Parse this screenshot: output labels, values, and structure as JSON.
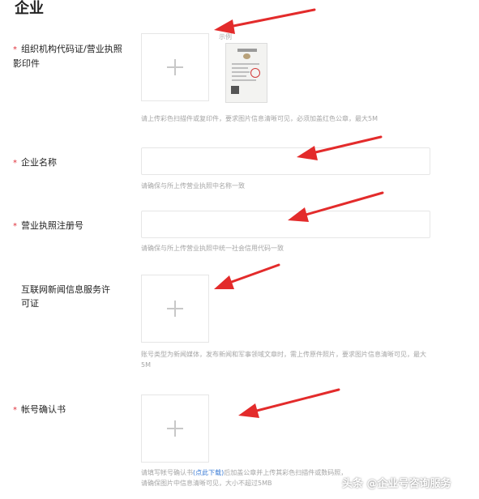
{
  "page": {
    "title": "企业"
  },
  "example_label": "示例",
  "fields": {
    "org_code": {
      "required": true,
      "label": "组织机构代码证/营业执照影印件",
      "hint": "请上传彩色扫描件或复印件，要求图片信息清晰可见，必须加盖红色公章，最大5M"
    },
    "company_name": {
      "required": true,
      "label": "企业名称",
      "value": "",
      "hint": "请确保与所上传营业执照中名称一致"
    },
    "license_no": {
      "required": true,
      "label": "营业执照注册号",
      "value": "",
      "hint": "请确保与所上传营业执照中统一社会信用代码一致"
    },
    "news_permit": {
      "required": false,
      "label": "互联网新闻信息服务许可证",
      "hint": "账号类型为新闻媒体，发布新闻和军事领域文章时，需上传原件照片，要求图片信息清晰可见，最大5M"
    },
    "account_confirm": {
      "required": true,
      "label": "帐号确认书",
      "hint_prefix": "请填写帐号确认书",
      "hint_link": "(点此下载)",
      "hint_suffix": "后加盖公章并上传其彩色扫描件或数码照，",
      "hint_line2": "请确保图片中信息清晰可见，大小不超过5MB"
    }
  },
  "required_mark": "*",
  "watermark": "头条 @企业号咨询服务",
  "colors": {
    "required": "#e0313c",
    "arrow": "#e32b2b",
    "link": "#3a7bd5",
    "hint": "#a6a6a6"
  }
}
